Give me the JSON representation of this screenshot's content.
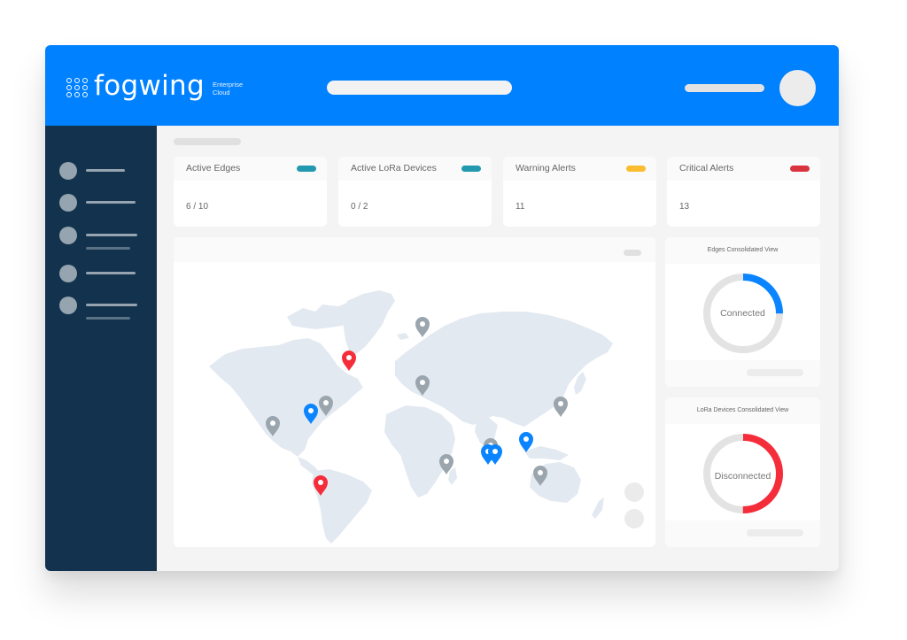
{
  "brand": {
    "name": "fogwing",
    "tagline_line1": "Enterprise",
    "tagline_line2": "Cloud",
    "primary_color": "#0081ff",
    "sidebar_color": "#12324d"
  },
  "sidebar": {
    "items": [
      {
        "id": "nav-1",
        "has_subline": false
      },
      {
        "id": "nav-2",
        "has_subline": false
      },
      {
        "id": "nav-3",
        "has_subline": true
      },
      {
        "id": "nav-4",
        "has_subline": false
      },
      {
        "id": "nav-5",
        "has_subline": true
      }
    ]
  },
  "stats": [
    {
      "title": "Active Edges",
      "value": "6 / 10",
      "tag_color": "#2399b0"
    },
    {
      "title": "Active LoRa Devices",
      "value": "0 / 2",
      "tag_color": "#2399b0"
    },
    {
      "title": "Warning Alerts",
      "value": "11",
      "tag_color": "#fbbd2f"
    },
    {
      "title": "Critical Alerts",
      "value": "13",
      "tag_color": "#d9333f"
    }
  ],
  "map": {
    "land_color": "#e3e9f1",
    "pin_colors": {
      "gray": "#9aa5ae",
      "blue": "#0a84ff",
      "red": "#f52d3a"
    },
    "pins": [
      {
        "label": "Western USA",
        "status": "gray"
      },
      {
        "label": "Central USA",
        "status": "blue"
      },
      {
        "label": "Eastern Canada",
        "status": "gray"
      },
      {
        "label": "Greenland",
        "status": "red"
      },
      {
        "label": "Arctic",
        "status": "gray"
      },
      {
        "label": "Scandinavia",
        "status": "gray"
      },
      {
        "label": "Ecuador",
        "status": "red"
      },
      {
        "label": "East Africa",
        "status": "gray"
      },
      {
        "label": "Pakistan",
        "status": "gray"
      },
      {
        "label": "India West",
        "status": "blue"
      },
      {
        "label": "India East",
        "status": "blue"
      },
      {
        "label": "South China",
        "status": "blue"
      },
      {
        "label": "Northeast China",
        "status": "gray"
      },
      {
        "label": "Borneo",
        "status": "gray"
      }
    ]
  },
  "consolidated": [
    {
      "title": "Edges Consolidated View",
      "center_label": "Connected",
      "highlight_fraction": 0.25,
      "color": "#0a84ff"
    },
    {
      "title": "LoRa Devices Consolidated View",
      "center_label": "Disconnected",
      "highlight_fraction": 0.5,
      "color": "#f52d3a"
    }
  ]
}
